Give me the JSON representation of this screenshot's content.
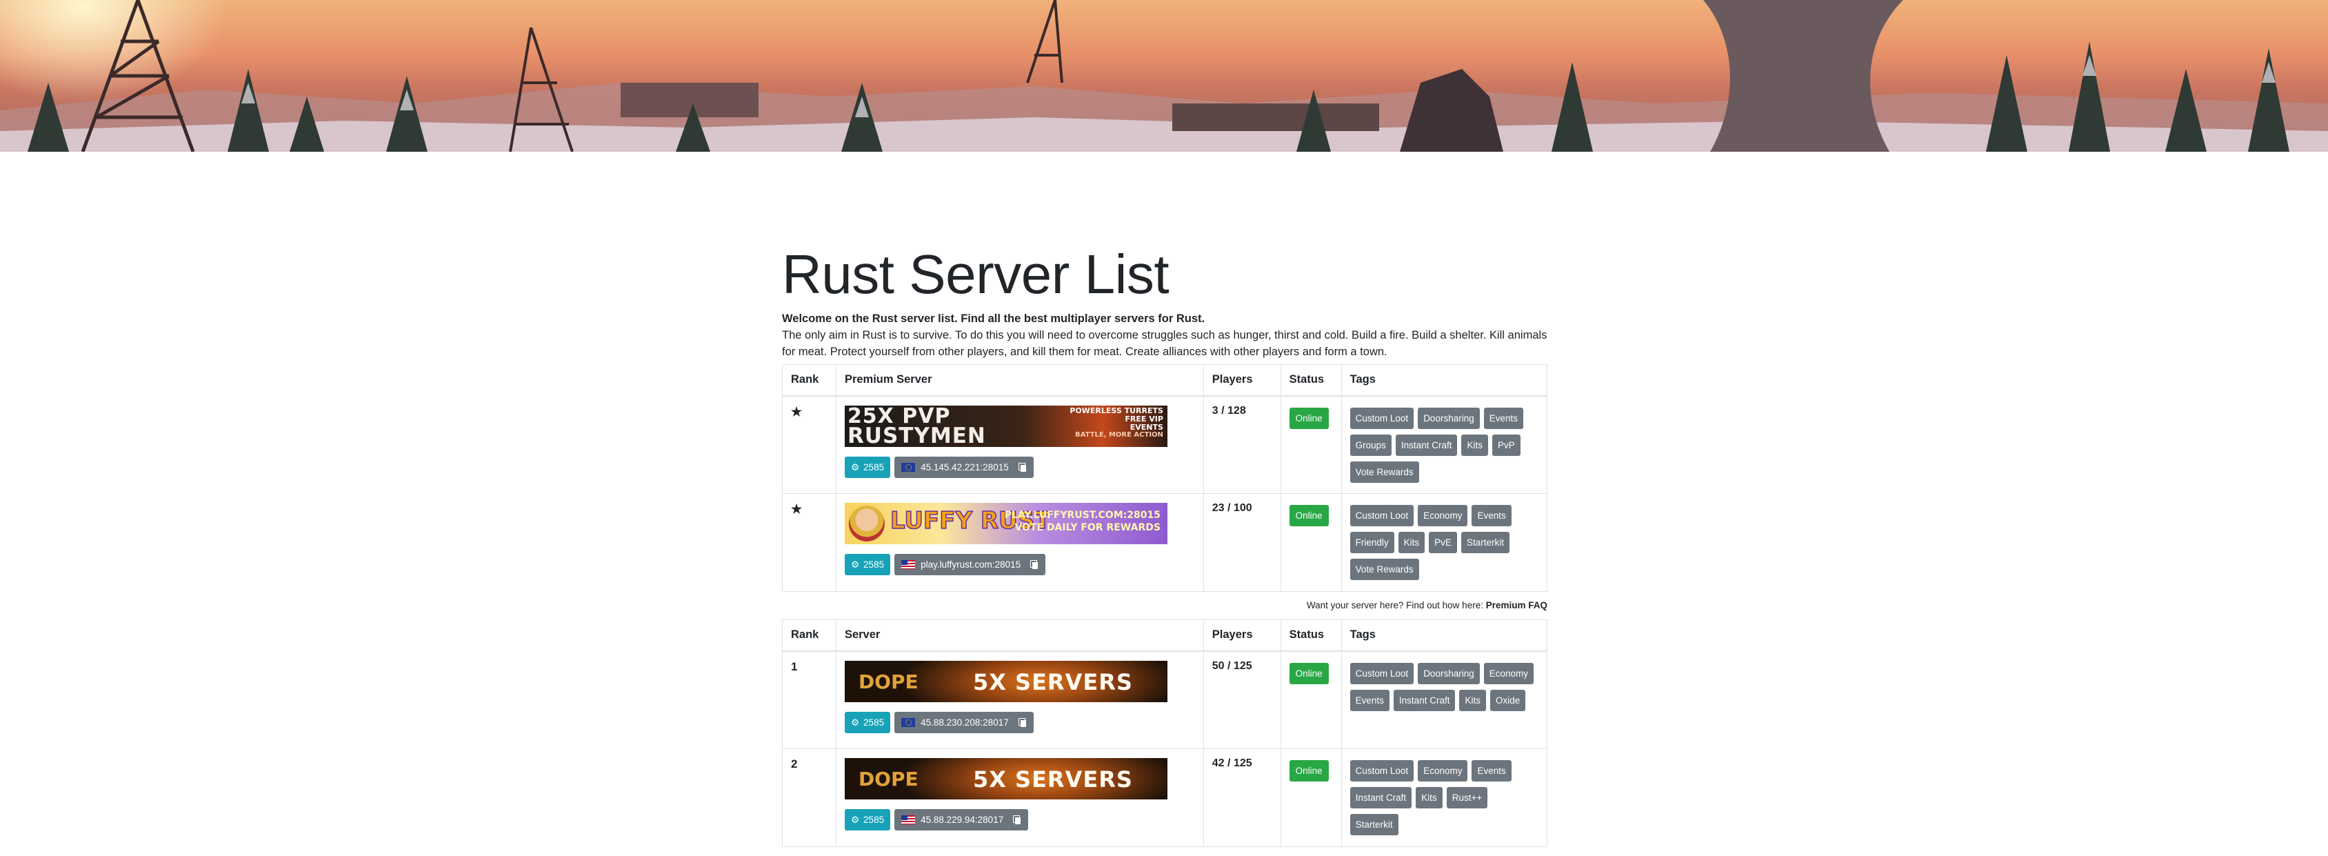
{
  "page": {
    "title": "Rust Server List",
    "intro_bold": "Welcome on the Rust server list. Find all the best multiplayer servers for Rust.",
    "intro_text": "The only aim in Rust is to survive. To do this you will need to overcome struggles such as hunger, thirst and cold. Build a fire. Build a shelter. Kill animals for meat. Protect yourself from other players, and kill them for meat. Create alliances with other players and form a town."
  },
  "premium_table": {
    "headers": {
      "rank": "Rank",
      "server": "Premium Server",
      "players": "Players",
      "status": "Status",
      "tags": "Tags"
    },
    "rows": [
      {
        "rank": "★",
        "banner": {
          "line1": "25X PVP",
          "line2": "RUSTYMEN",
          "side1": "POWERLESS TURRETS",
          "side2": "FREE VIP",
          "side3": "EVENTS",
          "side4": "BATTLE, MORE ACTION"
        },
        "votes": "2585",
        "address": "45.145.42.221:28015",
        "flag": "eu-flag",
        "players": "3 / 128",
        "status": "Online",
        "tags": [
          "Custom Loot",
          "Doorsharing",
          "Events",
          "Groups",
          "Instant Craft",
          "Kits",
          "PvP",
          "Vote Rewards"
        ]
      },
      {
        "rank": "★",
        "banner": {
          "line1": "LUFFY RUST",
          "side1": "PLAY.LUFFYRUST.COM:28015",
          "side2": "VOTE DAILY FOR REWARDS"
        },
        "votes": "2585",
        "address": "play.luffyrust.com:28015",
        "flag": "us-flag",
        "players": "23 / 100",
        "status": "Online",
        "tags": [
          "Custom Loot",
          "Economy",
          "Events",
          "Friendly",
          "Kits",
          "PvE",
          "Starterkit",
          "Vote Rewards"
        ]
      }
    ]
  },
  "premium_note": {
    "text": "Want your server here? Find out how here:",
    "link": "Premium FAQ"
  },
  "server_table": {
    "headers": {
      "rank": "Rank",
      "server": "Server",
      "players": "Players",
      "status": "Status",
      "tags": "Tags"
    },
    "rows": [
      {
        "rank": "1",
        "banner": {
          "logo": "DOPE",
          "text": "5X SERVERS"
        },
        "votes": "2585",
        "address": "45.88.230.208:28017",
        "flag": "eu-flag",
        "players": "50 / 125",
        "status": "Online",
        "tags": [
          "Custom Loot",
          "Doorsharing",
          "Economy",
          "Events",
          "Instant Craft",
          "Kits",
          "Oxide"
        ]
      },
      {
        "rank": "2",
        "banner": {
          "logo": "DOPE",
          "text": "5X SERVERS"
        },
        "votes": "2585",
        "address": "45.88.229.94:28017",
        "flag": "us-flag",
        "players": "42 / 125",
        "status": "Online",
        "tags": [
          "Custom Loot",
          "Economy",
          "Events",
          "Instant Craft",
          "Kits",
          "Rust++",
          "Starterkit"
        ]
      }
    ]
  },
  "colors": {
    "votes": "#17a2b8",
    "address": "#6c757d",
    "online": "#28a745",
    "tag": "#6c757d"
  }
}
